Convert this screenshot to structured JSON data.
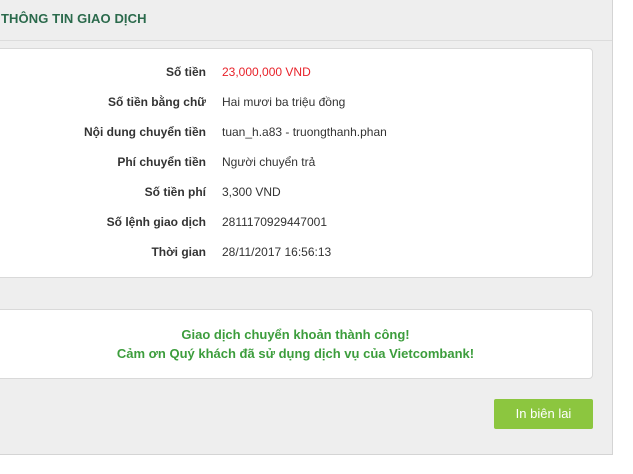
{
  "section": {
    "title": "THÔNG TIN GIAO DỊCH"
  },
  "details": {
    "rows": [
      {
        "label": "Số tiền",
        "value": "23,000,000 VND"
      },
      {
        "label": "Số tiền bằng chữ",
        "value": "Hai mươi ba triệu đồng"
      },
      {
        "label": "Nội dung chuyển tiền",
        "value": "tuan_h.a83 - truongthanh.phan"
      },
      {
        "label": "Phí chuyển tiền",
        "value": "Người chuyển trả"
      },
      {
        "label": "Số tiền phí",
        "value": "3,300 VND"
      },
      {
        "label": "Số lệnh giao dịch",
        "value": "2811170929447001"
      },
      {
        "label": "Thời gian",
        "value": "28/11/2017 16:56:13"
      }
    ]
  },
  "message": {
    "line1": "Giao dịch chuyển khoản thành công!",
    "line2": "Cảm ơn Quý khách đã sử dụng dịch vụ của Vietcombank!"
  },
  "actions": {
    "print_label": "In biên lai"
  },
  "colors": {
    "accent": "#8cc63f",
    "title": "#2b6a4c",
    "amount": "#e8222a",
    "success": "#3c9d3c"
  }
}
